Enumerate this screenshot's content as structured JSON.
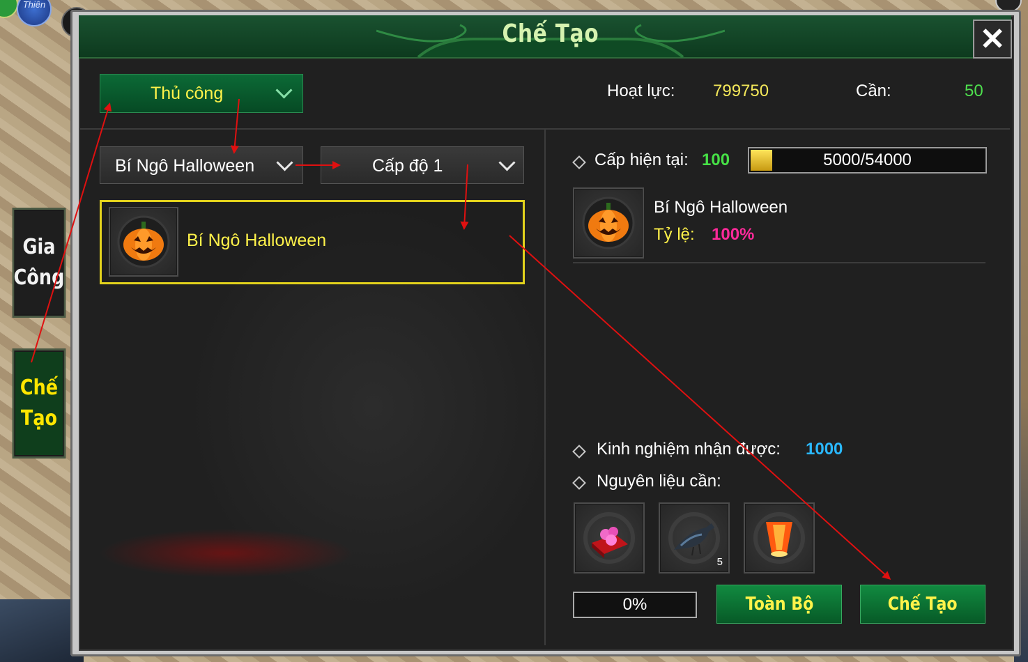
{
  "window": {
    "title": "Chế Tạo",
    "close_icon": "close-icon"
  },
  "side_tabs": {
    "gia_cong": [
      "Gia",
      "Công"
    ],
    "che_tao": [
      "Chế",
      "Tạo"
    ]
  },
  "avatar_label": "Thiên",
  "header": {
    "mode_label": "Thủ công",
    "hoat_luc_label": "Hoạt lực:",
    "hoat_luc_value": "799750",
    "can_label": "Cần:",
    "can_value": "50"
  },
  "filters": {
    "item_label": "Bí Ngô Halloween",
    "level_label": "Cấp độ 1"
  },
  "recipe_list": [
    {
      "name": "Bí Ngô Halloween",
      "icon": "pumpkin-icon"
    }
  ],
  "details": {
    "level_label": "Cấp hiện tại:",
    "level_value": "100",
    "exp_text": "5000/54000",
    "exp_progress_fraction": 0.0926,
    "result_name": "Bí Ngô Halloween",
    "rate_label": "Tỷ lệ:",
    "rate_value": "100%",
    "exp_gain_label": "Kinh nghiệm nhận được:",
    "exp_gain_value": "1000",
    "materials_label": "Nguyên liệu cần:",
    "materials": [
      {
        "icon": "pink-berries-icon",
        "count": ""
      },
      {
        "icon": "crow-icon",
        "count": "5"
      },
      {
        "icon": "sky-lantern-icon",
        "count": ""
      }
    ]
  },
  "footer": {
    "progress_text": "0%",
    "progress_fraction": 0,
    "all_button": "Toàn Bộ",
    "craft_button": "Chế Tạo"
  },
  "colors": {
    "accent_green": "#0c6a36",
    "title_green": "#d6f3b0",
    "highlight_yellow": "#fff24a",
    "value_green": "#46e046",
    "rate_pink": "#ff2a9a",
    "exp_blue": "#2ab8ff",
    "annotation_red": "#e01010"
  }
}
